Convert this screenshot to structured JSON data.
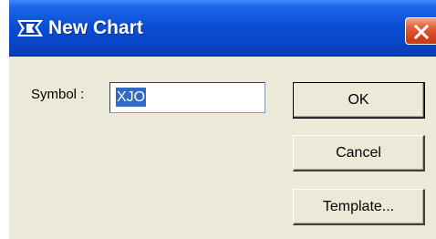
{
  "window": {
    "title": "New Chart",
    "icon": "app-logo-icon",
    "close_icon": "close-icon"
  },
  "form": {
    "symbol_label": "Symbol :",
    "symbol_value": "XJO"
  },
  "buttons": {
    "ok_label": "OK",
    "cancel_label": "Cancel",
    "template_label": "Template..."
  },
  "colors": {
    "titlebar": "#0a4fd6",
    "close_button": "#d4431c",
    "dialog_face": "#ece9d8",
    "selection": "#316ac5"
  }
}
